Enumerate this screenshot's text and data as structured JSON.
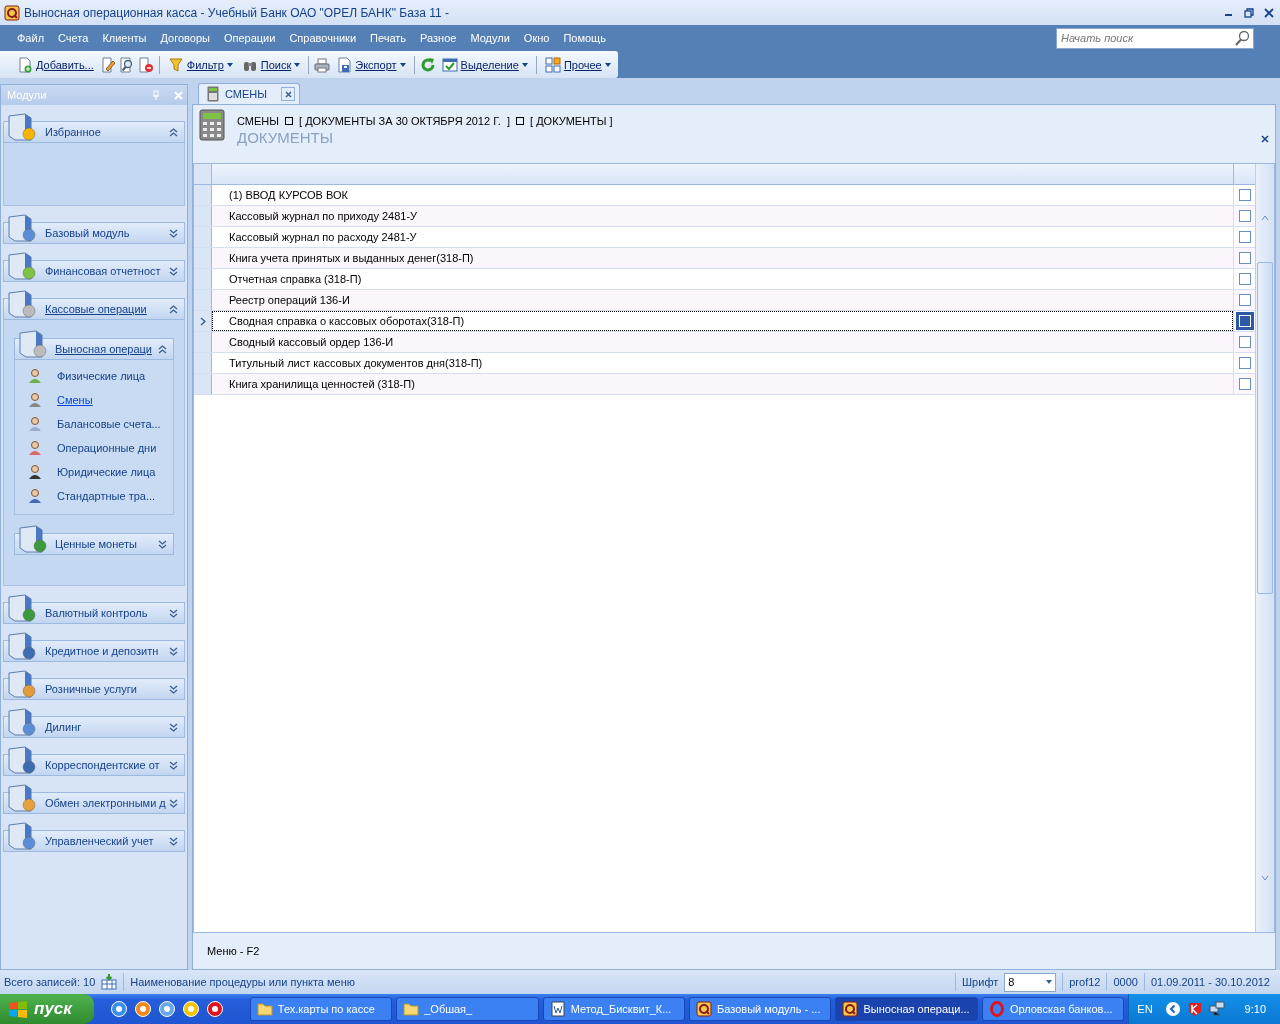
{
  "window": {
    "title": "Выносная операционная касса - Учебный Банк ОАО \"ОРЕЛ БАНК\" База 11 -"
  },
  "menu": [
    "Файл",
    "Счета",
    "Клиенты",
    "Договоры",
    "Операции",
    "Справочники",
    "Печать",
    "Разное",
    "Модули",
    "Окно",
    "Помощь"
  ],
  "search": {
    "placeholder": "Начать поиск"
  },
  "toolbar": [
    {
      "kind": "button",
      "label": "Добавить...",
      "dropdown": false
    },
    {
      "kind": "icon"
    },
    {
      "kind": "icon"
    },
    {
      "kind": "icon"
    },
    {
      "kind": "separator"
    },
    {
      "kind": "button",
      "label": "Фильтр",
      "dropdown": true
    },
    {
      "kind": "button",
      "label": "Поиск",
      "dropdown": true
    },
    {
      "kind": "separator"
    },
    {
      "kind": "icon"
    },
    {
      "kind": "button",
      "label": "Экспорт",
      "dropdown": true
    },
    {
      "kind": "separator"
    },
    {
      "kind": "icon"
    },
    {
      "kind": "button",
      "label": "Выделение",
      "dropdown": true
    },
    {
      "kind": "separator"
    },
    {
      "kind": "button",
      "label": "Прочее",
      "dropdown": true
    }
  ],
  "sidebar": {
    "title": "Модули",
    "groups": [
      {
        "label": "Избранное",
        "expanded": true,
        "selected": false
      },
      {
        "label": "Базовый модуль",
        "expanded": false,
        "selected": false
      },
      {
        "label": "Финансовая отчетност",
        "expanded": false,
        "selected": false
      },
      {
        "label": "Кассовые операции",
        "expanded": true,
        "selected": true,
        "children": [
          {
            "label": "Выносная операци",
            "expanded": true,
            "selected": true,
            "items": [
              {
                "label": "Физические лица",
                "selected": false
              },
              {
                "label": "Смены",
                "selected": true
              },
              {
                "label": "Балансовые счета...",
                "selected": false
              },
              {
                "label": "Операционные дни",
                "selected": false
              },
              {
                "label": "Юридические лица",
                "selected": false
              },
              {
                "label": "Стандартные тра...",
                "selected": false
              }
            ]
          },
          {
            "label": "Ценные монеты",
            "expanded": false,
            "selected": false
          }
        ]
      },
      {
        "label": "Валютный контроль",
        "expanded": false,
        "selected": false
      },
      {
        "label": "Кредитное и депозитн",
        "expanded": false,
        "selected": false
      },
      {
        "label": "Розничные услуги",
        "expanded": false,
        "selected": false
      },
      {
        "label": "Дилинг",
        "expanded": false,
        "selected": false
      },
      {
        "label": "Корреспондентские от",
        "expanded": false,
        "selected": false
      },
      {
        "label": "Обмен электронными д",
        "expanded": false,
        "selected": false
      },
      {
        "label": "Управленческий учет",
        "expanded": false,
        "selected": false
      }
    ]
  },
  "tabs": [
    {
      "label": "СМЕНЫ",
      "selected": true
    }
  ],
  "header": {
    "breadcrumb": [
      "СМЕНЫ",
      "[ ДОКУМЕНТЫ ЗА 30 ОКТЯБРЯ 2012 Г.  ]",
      "[ ДОКУМЕНТЫ ]"
    ],
    "title": "ДОКУМЕНТЫ"
  },
  "table": {
    "rows": [
      {
        "name": "(1) ВВОД КУРСОВ ВОК",
        "selected": false
      },
      {
        "name": "Кассовый журнал по приходу 2481-У",
        "selected": false
      },
      {
        "name": "Кассовый журнал по расходу 2481-У",
        "selected": false
      },
      {
        "name": "Книга учета принятых и выданных денег(318-П)",
        "selected": false
      },
      {
        "name": "Отчетная справка (318-П)",
        "selected": false
      },
      {
        "name": "Реестр операций 136-И",
        "selected": false
      },
      {
        "name": "Сводная справка о кассовых оборотах(318-П)",
        "selected": true
      },
      {
        "name": "Сводный кассовый ордер 136-И",
        "selected": false
      },
      {
        "name": "Титульный лист кассовых документов дня(318-П)",
        "selected": false
      },
      {
        "name": "Книга хранилища ценностей (318-П)",
        "selected": false
      }
    ]
  },
  "footer_hint": "Меню - F2",
  "status_bar": {
    "records": "Всего записей: 10",
    "hint": "Наименование процедуры или пункта меню",
    "font_label": "Шрифт",
    "font_size": "8",
    "user": "prof12",
    "code": "0000",
    "period": "01.09.2011 - 30.10.2012"
  },
  "taskbar": {
    "start": "пуск",
    "tasks": [
      {
        "label": "Тех.карты по кассе",
        "selected": false
      },
      {
        "label": "_Обшая_",
        "selected": false
      },
      {
        "label": "Метод_Бисквит_К...",
        "selected": false
      },
      {
        "label": "Базовый модуль - ...",
        "selected": false
      },
      {
        "label": "Выносная операци...",
        "selected": true
      },
      {
        "label": "Орловская банков...",
        "selected": false
      }
    ],
    "language": "EN",
    "time": "9:10"
  }
}
